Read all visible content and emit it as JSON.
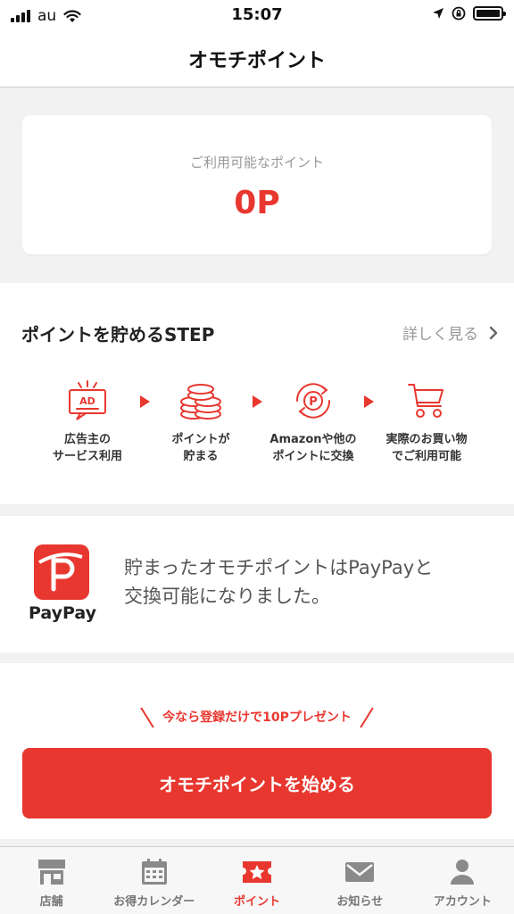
{
  "status_bar": {
    "carrier": "au",
    "time": "15:07",
    "icons": [
      "signal-icon",
      "wifi-icon",
      "location-icon",
      "orientation-lock-icon",
      "battery-icon"
    ]
  },
  "nav": {
    "title": "オモチポイント"
  },
  "points_card": {
    "label": "ご利用可能なポイント",
    "value": "0P"
  },
  "steps": {
    "title": "ポイントを貯めるSTEP",
    "more_label": "詳しく見る",
    "items": [
      {
        "icon": "ad-icon",
        "line1": "広告主の",
        "line2": "サービス利用"
      },
      {
        "icon": "coins-stack-icon",
        "line1": "ポイントが",
        "line2": "貯まる"
      },
      {
        "icon": "point-exchange-icon",
        "line1": "Amazonや他の",
        "line2": "ポイントに交換"
      },
      {
        "icon": "shopping-cart-icon",
        "line1": "実際のお買い物",
        "line2": "でご利用可能"
      }
    ]
  },
  "paypay": {
    "logo_text": "PayPay",
    "message_line1": "貯まったオモチポイントはPayPayと",
    "message_line2": "交換可能になりました。"
  },
  "cta": {
    "promo": "今なら登録だけで10Pプレゼント",
    "button_label": "オモチポイントを始める"
  },
  "tabs": [
    {
      "label": "店舗",
      "icon": "store-icon",
      "active": false
    },
    {
      "label": "お得カレンダー",
      "icon": "calendar-icon",
      "active": false
    },
    {
      "label": "ポイント",
      "icon": "point-ticket-icon",
      "active": true
    },
    {
      "label": "お知らせ",
      "icon": "mail-icon",
      "active": false
    },
    {
      "label": "アカウント",
      "icon": "account-icon",
      "active": false
    }
  ],
  "colors": {
    "accent": "#e8372f",
    "background": "#f1f2f1",
    "inactive_tab": "#777777"
  }
}
